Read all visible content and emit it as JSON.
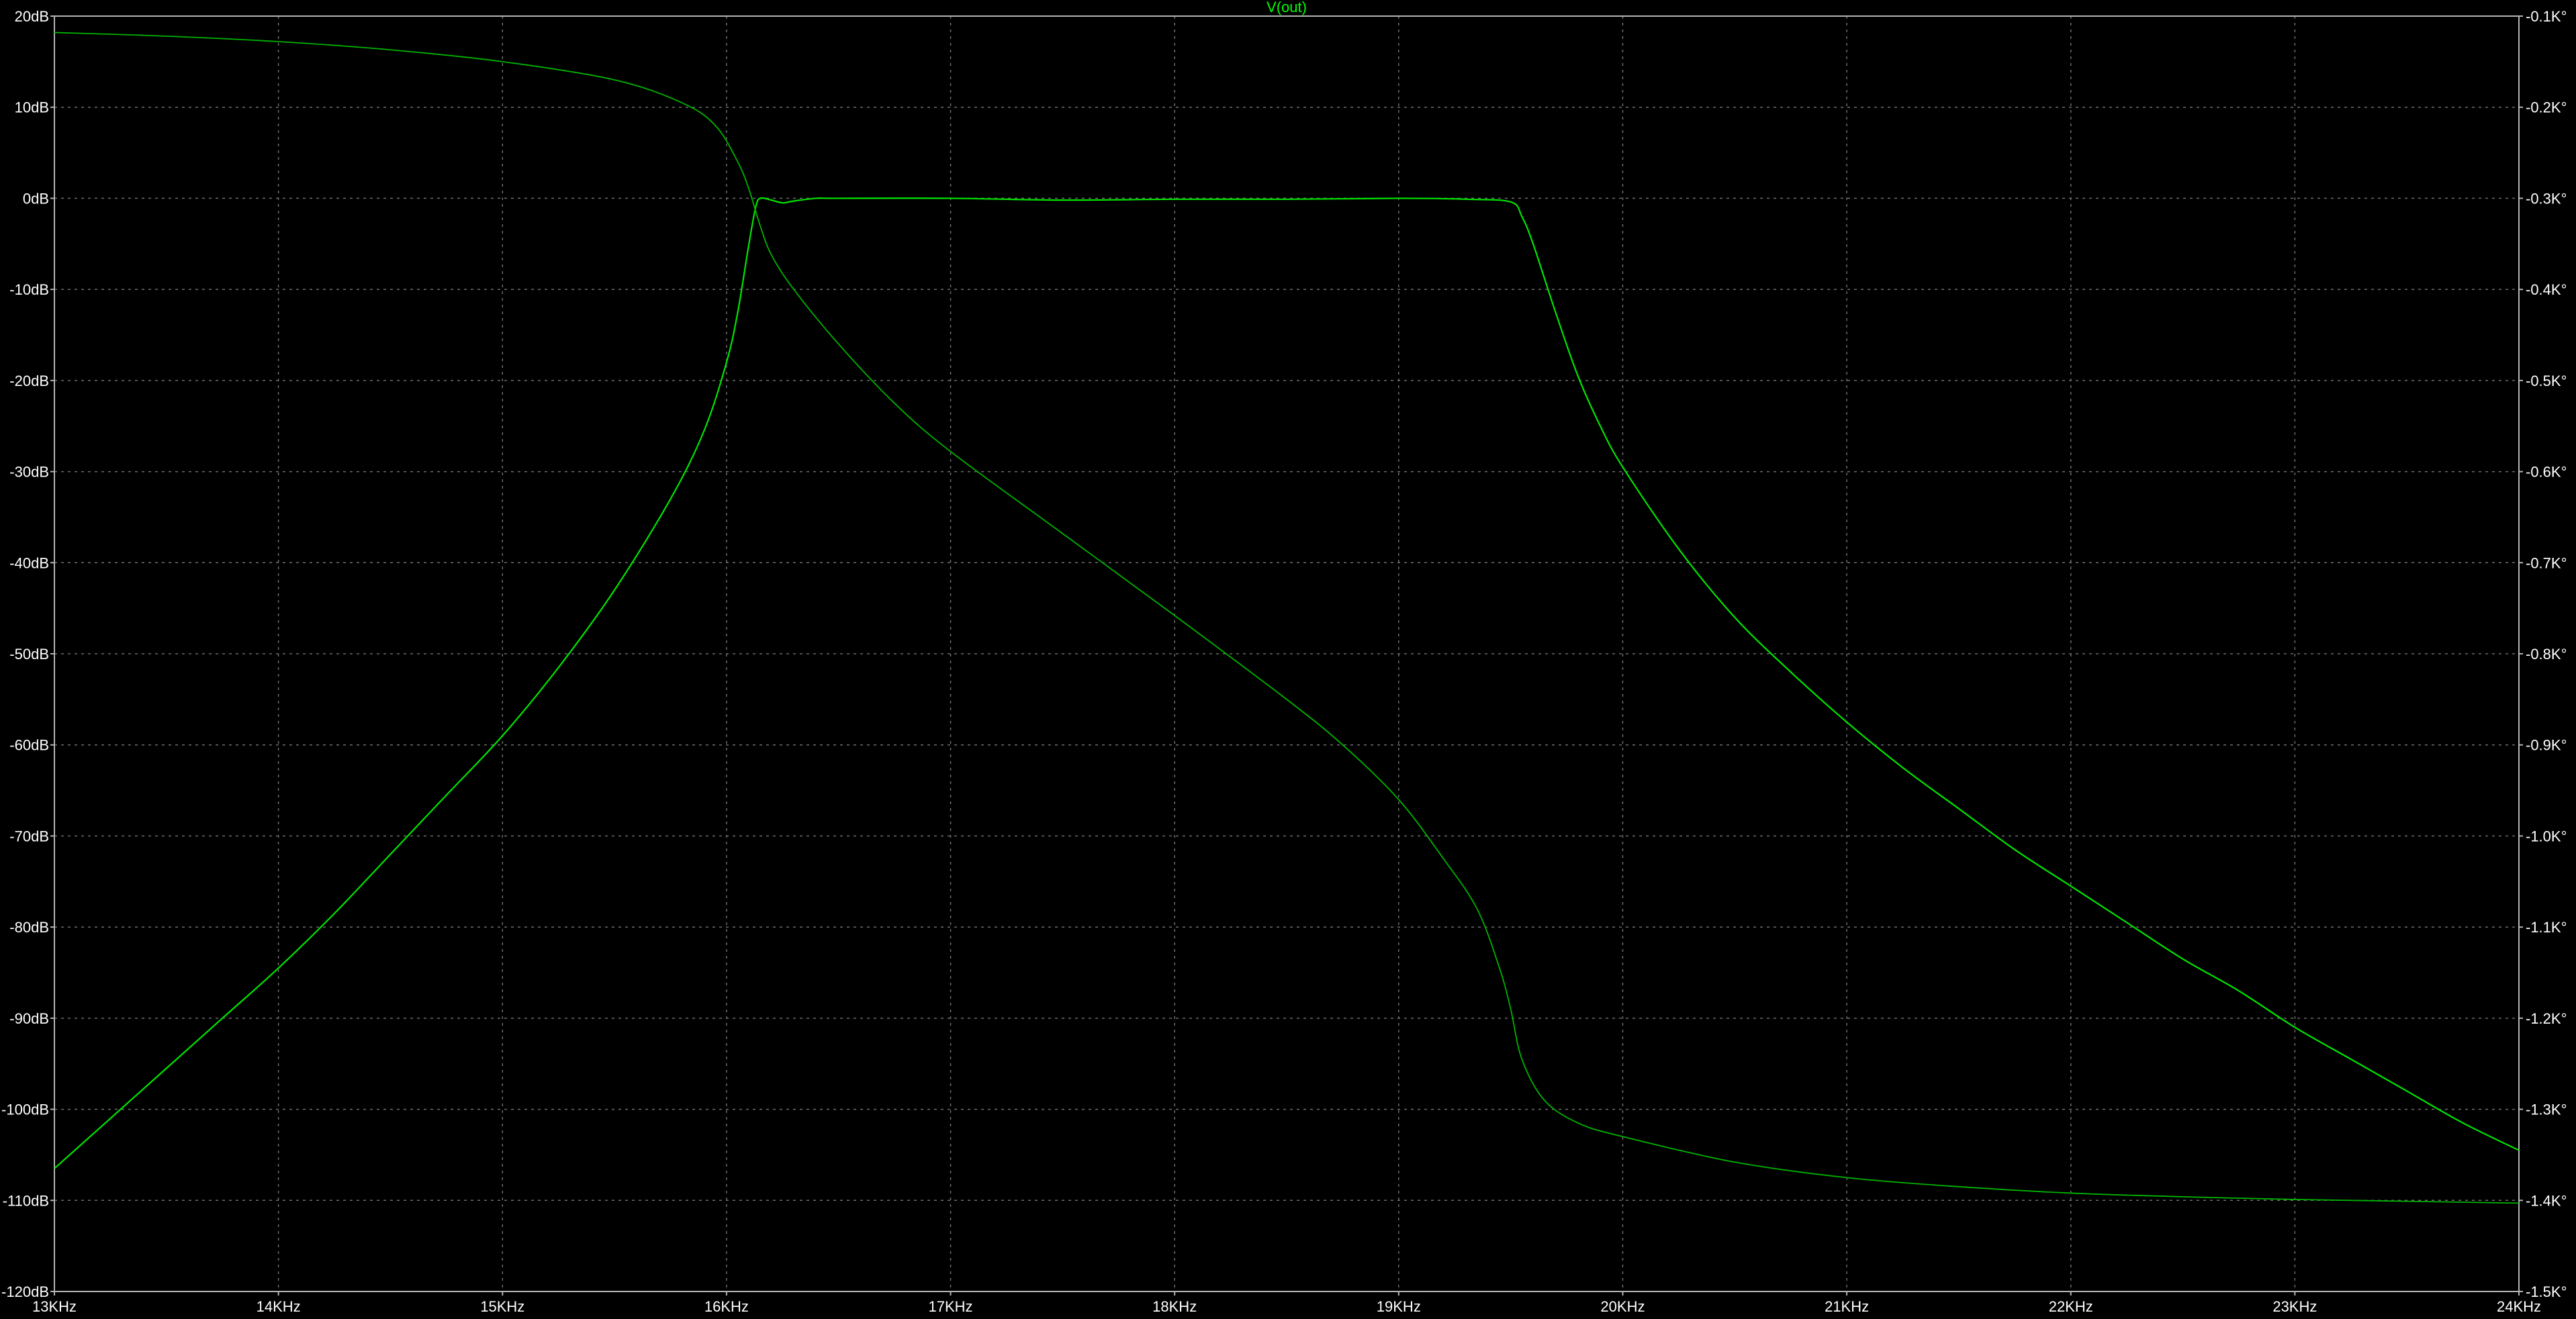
{
  "chart_data": {
    "type": "line",
    "title": "V(out)",
    "title_color": "#00ff00",
    "background": "#000000",
    "grid": true,
    "grid_color": "#6e6e6e",
    "frame_color": "#b4b4b4",
    "x_axis": {
      "unit": "Hz",
      "range": [
        13000,
        24000
      ],
      "ticks": [
        {
          "value": 13000,
          "label": "13KHz"
        },
        {
          "value": 14000,
          "label": "14KHz"
        },
        {
          "value": 15000,
          "label": "15KHz"
        },
        {
          "value": 16000,
          "label": "16KHz"
        },
        {
          "value": 17000,
          "label": "17KHz"
        },
        {
          "value": 18000,
          "label": "18KHz"
        },
        {
          "value": 19000,
          "label": "19KHz"
        },
        {
          "value": 20000,
          "label": "20KHz"
        },
        {
          "value": 21000,
          "label": "21KHz"
        },
        {
          "value": 22000,
          "label": "22KHz"
        },
        {
          "value": 23000,
          "label": "23KHz"
        },
        {
          "value": 24000,
          "label": "24KHz"
        }
      ]
    },
    "y_left": {
      "unit": "dB",
      "range": [
        -120,
        20
      ],
      "ticks": [
        {
          "value": 20,
          "label": "20dB"
        },
        {
          "value": 10,
          "label": "10dB"
        },
        {
          "value": 0,
          "label": "0dB"
        },
        {
          "value": -10,
          "label": "-10dB"
        },
        {
          "value": -20,
          "label": "-20dB"
        },
        {
          "value": -30,
          "label": "-30dB"
        },
        {
          "value": -40,
          "label": "-40dB"
        },
        {
          "value": -50,
          "label": "-50dB"
        },
        {
          "value": -60,
          "label": "-60dB"
        },
        {
          "value": -70,
          "label": "-70dB"
        },
        {
          "value": -80,
          "label": "-80dB"
        },
        {
          "value": -90,
          "label": "-90dB"
        },
        {
          "value": -100,
          "label": "-100dB"
        },
        {
          "value": -110,
          "label": "-110dB"
        },
        {
          "value": -120,
          "label": "-120dB"
        }
      ]
    },
    "y_right": {
      "unit": "°",
      "range": [
        -1500,
        -100
      ],
      "ticks": [
        {
          "value": -100,
          "label": "-0.1K°"
        },
        {
          "value": -200,
          "label": "-0.2K°"
        },
        {
          "value": -300,
          "label": "-0.3K°"
        },
        {
          "value": -400,
          "label": "-0.4K°"
        },
        {
          "value": -500,
          "label": "-0.5K°"
        },
        {
          "value": -600,
          "label": "-0.6K°"
        },
        {
          "value": -700,
          "label": "-0.7K°"
        },
        {
          "value": -800,
          "label": "-0.8K°"
        },
        {
          "value": -900,
          "label": "-0.9K°"
        },
        {
          "value": -1000,
          "label": "-1.0K°"
        },
        {
          "value": -1100,
          "label": "-1.1K°"
        },
        {
          "value": -1200,
          "label": "-1.2K°"
        },
        {
          "value": -1300,
          "label": "-1.3K°"
        },
        {
          "value": -1400,
          "label": "-1.4K°"
        },
        {
          "value": -1500,
          "label": "-1.5K°"
        }
      ]
    },
    "series": [
      {
        "axis": "left",
        "color": "#00e600",
        "points": [
          [
            13000,
            -106.5
          ],
          [
            13250,
            -101
          ],
          [
            13500,
            -95.5
          ],
          [
            13750,
            -90
          ],
          [
            14000,
            -84.5
          ],
          [
            14250,
            -78.5
          ],
          [
            14500,
            -72
          ],
          [
            14750,
            -65.5
          ],
          [
            15000,
            -59
          ],
          [
            15250,
            -51.5
          ],
          [
            15500,
            -43
          ],
          [
            15750,
            -33
          ],
          [
            15900,
            -25.5
          ],
          [
            16000,
            -18
          ],
          [
            16050,
            -12.5
          ],
          [
            16100,
            -5
          ],
          [
            16130,
            -1
          ],
          [
            16150,
            0
          ],
          [
            16200,
            -0.2
          ],
          [
            16250,
            -0.5
          ],
          [
            16300,
            -0.3
          ],
          [
            16400,
            0
          ],
          [
            16500,
            0
          ],
          [
            17000,
            0
          ],
          [
            17500,
            -0.2
          ],
          [
            18000,
            -0.1
          ],
          [
            18500,
            -0.1
          ],
          [
            19000,
            0
          ],
          [
            19300,
            -0.1
          ],
          [
            19500,
            -0.4
          ],
          [
            19550,
            -2
          ],
          [
            19600,
            -5
          ],
          [
            19700,
            -12.5
          ],
          [
            19800,
            -19.5
          ],
          [
            19900,
            -25
          ],
          [
            20000,
            -29.5
          ],
          [
            20250,
            -38.5
          ],
          [
            20500,
            -46
          ],
          [
            20750,
            -52
          ],
          [
            21000,
            -57.5
          ],
          [
            21250,
            -62.5
          ],
          [
            21500,
            -67
          ],
          [
            21750,
            -71.5
          ],
          [
            22000,
            -75.5
          ],
          [
            22250,
            -79.5
          ],
          [
            22500,
            -83.5
          ],
          [
            22750,
            -87
          ],
          [
            23000,
            -91
          ],
          [
            23250,
            -94.5
          ],
          [
            23500,
            -98
          ],
          [
            23750,
            -101.5
          ],
          [
            24000,
            -104.5
          ]
        ]
      },
      {
        "axis": "right",
        "color": "#00b400",
        "points": [
          [
            13000,
            -118
          ],
          [
            13500,
            -122
          ],
          [
            14000,
            -128
          ],
          [
            14500,
            -137
          ],
          [
            15000,
            -150
          ],
          [
            15500,
            -170
          ],
          [
            15800,
            -195
          ],
          [
            15950,
            -220
          ],
          [
            16050,
            -260
          ],
          [
            16100,
            -290
          ],
          [
            16150,
            -330
          ],
          [
            16200,
            -362
          ],
          [
            16300,
            -400
          ],
          [
            16500,
            -460
          ],
          [
            16750,
            -525
          ],
          [
            17000,
            -578
          ],
          [
            17500,
            -668
          ],
          [
            18000,
            -758
          ],
          [
            18500,
            -850
          ],
          [
            18750,
            -900
          ],
          [
            19000,
            -960
          ],
          [
            19200,
            -1025
          ],
          [
            19350,
            -1080
          ],
          [
            19450,
            -1145
          ],
          [
            19500,
            -1190
          ],
          [
            19550,
            -1245
          ],
          [
            19650,
            -1290
          ],
          [
            19800,
            -1315
          ],
          [
            20000,
            -1330
          ],
          [
            20500,
            -1358
          ],
          [
            21000,
            -1375
          ],
          [
            21500,
            -1385
          ],
          [
            22000,
            -1392
          ],
          [
            22500,
            -1396
          ],
          [
            23000,
            -1399
          ],
          [
            23500,
            -1401
          ],
          [
            24000,
            -1403
          ]
        ]
      }
    ]
  }
}
